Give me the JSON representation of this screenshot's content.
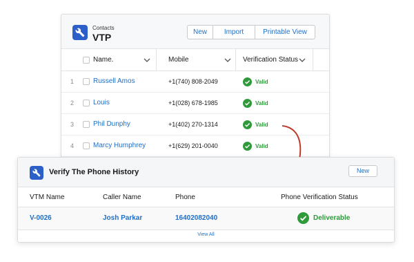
{
  "contacts": {
    "object_label": "Contacts",
    "list_title": "VTP",
    "icon": "wrench-icon",
    "buttons": {
      "new": "New",
      "import": "Import",
      "printable_view": "Printable View"
    },
    "columns": {
      "name": "Name.",
      "mobile": "Mobile",
      "verification_status": "Verification Status"
    },
    "rows": [
      {
        "num": "1",
        "name": "Russell Amos",
        "mobile": "+1(740) 808-2049",
        "status": "Valid"
      },
      {
        "num": "2",
        "name": "Louis",
        "mobile": "+1(028) 678-1985",
        "status": "Valid"
      },
      {
        "num": "3",
        "name": "Phil Dunphy",
        "mobile": "+1(402) 270-1314",
        "status": "Valid"
      },
      {
        "num": "4",
        "name": "Marcy Humphrey",
        "mobile": "+1(629) 201-0040",
        "status": "Valid"
      }
    ]
  },
  "verify": {
    "title": "Verify The Phone History",
    "icon": "wrench-icon",
    "new_label": "New",
    "columns": {
      "vtm_name": "VTM Name",
      "caller_name": "Caller Name",
      "phone": "Phone",
      "status": "Phone Verification Status"
    },
    "row": {
      "vtm_name": "V-0026",
      "caller_name": "Josh Parkar",
      "phone": "16402082040",
      "status": "Deliverable"
    },
    "view_all": "View All"
  },
  "colors": {
    "accent_blue": "#1e6fc8",
    "icon_blue": "#2c5fc7",
    "valid_green": "#2e9a3a",
    "arrow_red": "#c0392b"
  }
}
